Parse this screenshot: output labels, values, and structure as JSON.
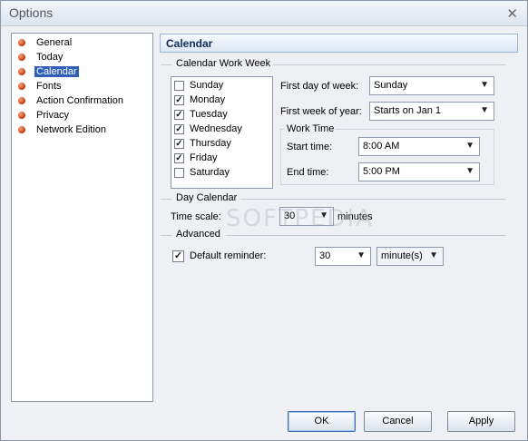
{
  "window": {
    "title": "Options",
    "close_glyph": "✕"
  },
  "nav": {
    "items": [
      {
        "label": "General"
      },
      {
        "label": "Today"
      },
      {
        "label": "Calendar",
        "selected": true
      },
      {
        "label": "Fonts"
      },
      {
        "label": "Action Confirmation"
      },
      {
        "label": "Privacy"
      },
      {
        "label": "Network Edition"
      }
    ]
  },
  "section": {
    "title": "Calendar"
  },
  "work_week": {
    "group_title": "Calendar Work Week",
    "days": [
      {
        "label": "Sunday",
        "checked": false
      },
      {
        "label": "Monday",
        "checked": true
      },
      {
        "label": "Tuesday",
        "checked": true
      },
      {
        "label": "Wednesday",
        "checked": true
      },
      {
        "label": "Thursday",
        "checked": true
      },
      {
        "label": "Friday",
        "checked": true
      },
      {
        "label": "Saturday",
        "checked": false
      }
    ],
    "first_day_label": "First day of week:",
    "first_day_value": "Sunday",
    "first_week_label": "First week of year:",
    "first_week_value": "Starts on Jan 1",
    "work_time_title": "Work Time",
    "start_label": "Start time:",
    "start_value": "8:00 AM",
    "end_label": "End time:",
    "end_value": "5:00 PM"
  },
  "day_calendar": {
    "group_title": "Day Calendar",
    "time_scale_label": "Time scale:",
    "time_scale_value": "30",
    "time_scale_unit": "minutes"
  },
  "advanced": {
    "group_title": "Advanced",
    "default_reminder_label": "Default reminder:",
    "default_reminder_checked": true,
    "reminder_value": "30",
    "reminder_unit": "minute(s)"
  },
  "buttons": {
    "ok": "OK",
    "cancel": "Cancel",
    "apply": "Apply"
  },
  "watermark": "SOFTPEDIA"
}
